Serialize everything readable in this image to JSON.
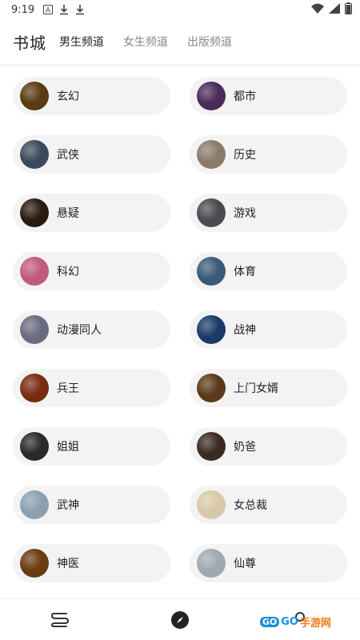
{
  "status_bar": {
    "time": "9:19"
  },
  "header": {
    "title": "书城",
    "tabs": [
      {
        "label": "男生频道",
        "active": true
      },
      {
        "label": "女生频道",
        "active": false
      },
      {
        "label": "出版频道",
        "active": false
      }
    ]
  },
  "categories": [
    {
      "label": "玄幻",
      "color": "#5a3a12"
    },
    {
      "label": "都市",
      "color": "#4a2a5a"
    },
    {
      "label": "武侠",
      "color": "#3a4a5a"
    },
    {
      "label": "历史",
      "color": "#8a7a6a"
    },
    {
      "label": "悬疑",
      "color": "#2a1a10"
    },
    {
      "label": "游戏",
      "color": "#4a4a50"
    },
    {
      "label": "科幻",
      "color": "#c05a7a"
    },
    {
      "label": "体育",
      "color": "#3a5a7a"
    },
    {
      "label": "动漫同人",
      "color": "#6a6a80"
    },
    {
      "label": "战神",
      "color": "#1a3a6a"
    },
    {
      "label": "兵王",
      "color": "#7a2a10"
    },
    {
      "label": "上门女婿",
      "color": "#5a3a1a"
    },
    {
      "label": "姐姐",
      "color": "#2a2a2a"
    },
    {
      "label": "奶爸",
      "color": "#3a2a20"
    },
    {
      "label": "武神",
      "color": "#8aa0b0"
    },
    {
      "label": "女总裁",
      "color": "#d8c8a8"
    },
    {
      "label": "神医",
      "color": "#6a3a10"
    },
    {
      "label": "仙尊",
      "color": "#a0a8b0"
    }
  ],
  "watermark": {
    "badge": "GO",
    "brand": "GO",
    "tail": "手游网"
  }
}
